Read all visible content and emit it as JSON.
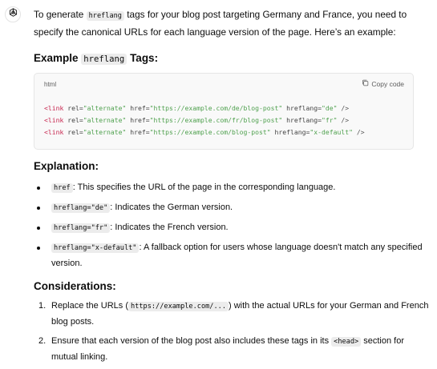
{
  "intro": {
    "part1": "To generate ",
    "code": "hreflang",
    "part2": " tags for your blog post targeting Germany and France, you need to specify the canonical URLs for each language version of the page. Here’s an example:"
  },
  "example_heading": {
    "prefix": "Example ",
    "code": "hreflang",
    "suffix": " Tags:"
  },
  "code_block": {
    "language": "html",
    "copy_label": "Copy code",
    "lines": [
      {
        "open": "<link ",
        "rel_attr": "rel=",
        "rel_val": "\"alternate\"",
        "href_attr": " href=",
        "href_val": "\"https://example.com/de/blog-post\"",
        "lang_attr": " hreflang=",
        "lang_val": "\"de\"",
        "close": " />"
      },
      {
        "open": "<link ",
        "rel_attr": "rel=",
        "rel_val": "\"alternate\"",
        "href_attr": " href=",
        "href_val": "\"https://example.com/fr/blog-post\"",
        "lang_attr": " hreflang=",
        "lang_val": "\"fr\"",
        "close": " />"
      },
      {
        "open": "<link ",
        "rel_attr": "rel=",
        "rel_val": "\"alternate\"",
        "href_attr": " href=",
        "href_val": "\"https://example.com/blog-post\"",
        "lang_attr": " hreflang=",
        "lang_val": "\"x-default\"",
        "close": " />"
      }
    ]
  },
  "explanation": {
    "heading": "Explanation:",
    "items": [
      {
        "code": "href",
        "text": ": This specifies the URL of the page in the corresponding language."
      },
      {
        "code": "hreflang=\"de\"",
        "text": ": Indicates the German version."
      },
      {
        "code": "hreflang=\"fr\"",
        "text": ": Indicates the French version."
      },
      {
        "code": "hreflang=\"x-default\"",
        "text": ": A fallback option for users whose language doesn't match any specified version."
      }
    ]
  },
  "considerations": {
    "heading": "Considerations:",
    "items": [
      {
        "num": "1.",
        "pre": "Replace the URLs (",
        "code": "https://example.com/...",
        "post": ") with the actual URLs for your German and French blog posts."
      },
      {
        "num": "2.",
        "pre": "Ensure that each version of the blog post also includes these tags in its ",
        "code": "<head>",
        "post": " section for mutual linking."
      }
    ]
  },
  "icons": {
    "assistant": "openai-logo-icon",
    "copy": "copy-icon"
  }
}
